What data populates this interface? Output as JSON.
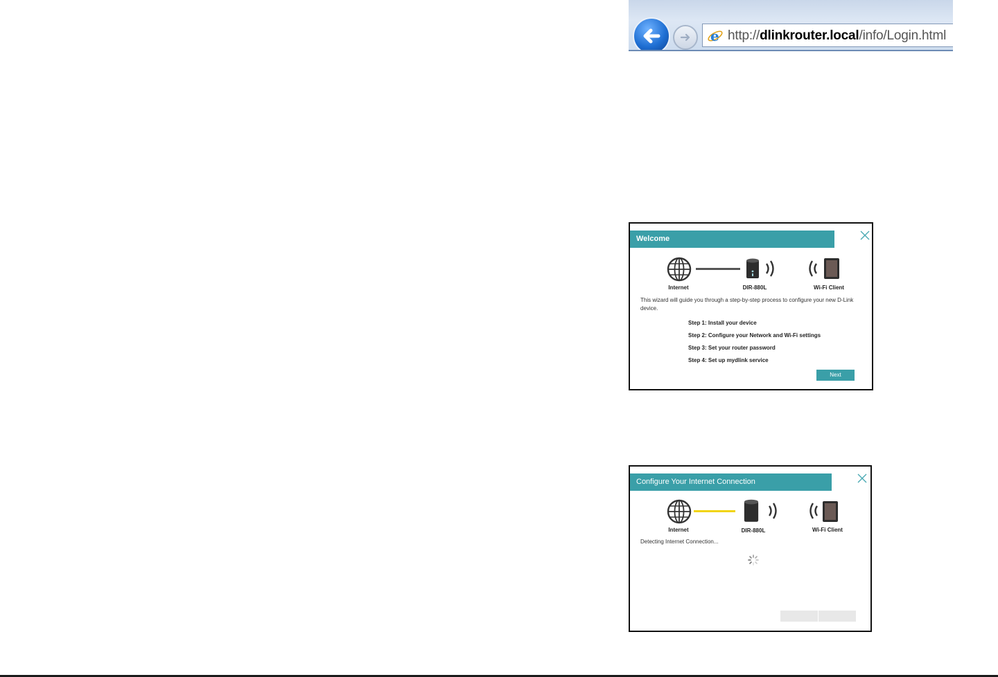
{
  "browser": {
    "url_scheme": "http://",
    "url_host": "dlinkrouter.local",
    "url_path": "/info/Login.html"
  },
  "welcome_dialog": {
    "title": "Welcome",
    "labels": {
      "internet": "Internet",
      "router": "DIR-880L",
      "client": "Wi-Fi Client"
    },
    "intro": "This wizard will guide you through a step-by-step process to configure your new D-Link device.",
    "steps": [
      "Step 1: Install your device",
      "Step 2: Configure your Network and Wi-Fi settings",
      "Step 3: Set your router password",
      "Step 4: Set up mydlink service"
    ],
    "next_label": "Next"
  },
  "connection_dialog": {
    "title": "Configure Your Internet Connection",
    "labels": {
      "internet": "Internet",
      "router": "DIR-880L",
      "client": "Wi-Fi Client"
    },
    "status": "Detecting Internet Connection..."
  },
  "colors": {
    "teal": "#3a9fa8",
    "detect_line": "#f1d40f",
    "connected_line": "#555555"
  }
}
